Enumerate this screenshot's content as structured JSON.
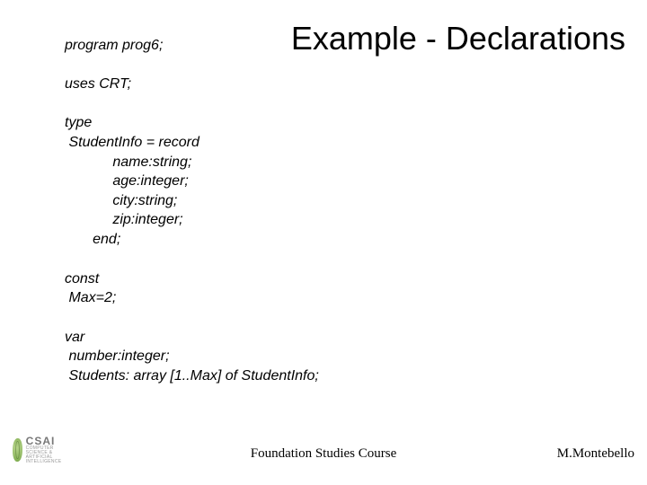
{
  "title": "Example - Declarations",
  "code": {
    "l1": "program prog6;",
    "l2": "uses CRT;",
    "type_kw": "type",
    "type_line": " StudentInfo = record",
    "f1": "            name:string;",
    "f2": "            age:integer;",
    "f3": "            city:string;",
    "f4": "            zip:integer;",
    "end": "       end;",
    "const_kw": "const",
    "const_line": " Max=2;",
    "var_kw": "var",
    "var1": " number:integer;",
    "var2": " Students: array [1..Max] of StudentInfo;"
  },
  "footer": {
    "center": "Foundation Studies Course",
    "right": "M.Montebello"
  },
  "logo": {
    "big": "CSAI",
    "small": "COMPUTER SCIENCE & ARTIFICIAL INTELLIGENCE"
  }
}
